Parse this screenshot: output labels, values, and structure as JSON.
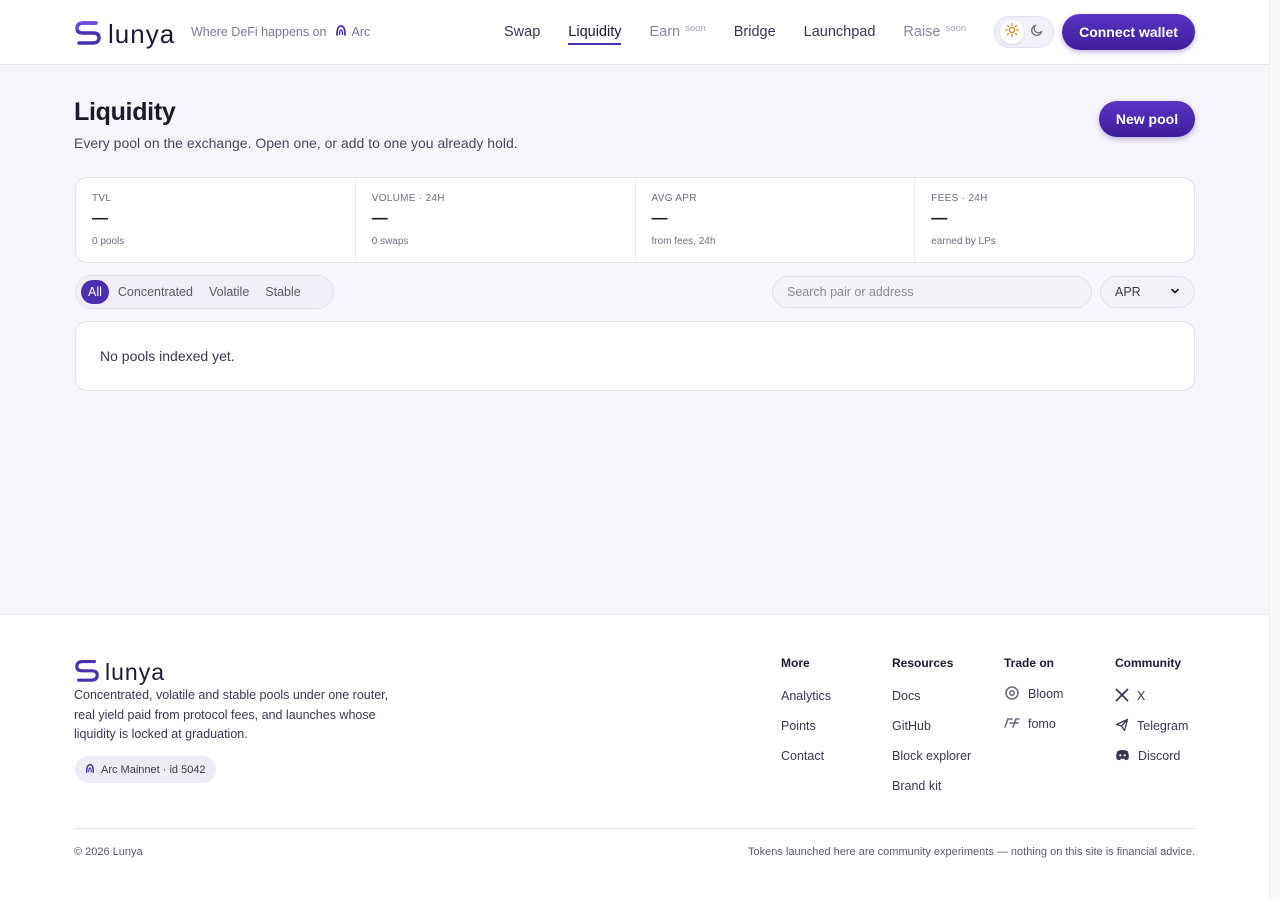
{
  "brand": {
    "name": "lunya",
    "accent": "#4a2fb0"
  },
  "header": {
    "tagline": "Where DeFi happens on",
    "chain": "Arc",
    "nav": [
      {
        "label": "Swap",
        "soon": ""
      },
      {
        "label": "Liquidity",
        "soon": ""
      },
      {
        "label": "Earn",
        "soon": "soon"
      },
      {
        "label": "Bridge",
        "soon": ""
      },
      {
        "label": "Launchpad",
        "soon": ""
      },
      {
        "label": "Raise",
        "soon": "soon"
      }
    ],
    "active_nav": "Liquidity",
    "theme_icons": [
      "sun-icon",
      "moon-icon"
    ],
    "connect_label": "Connect wallet"
  },
  "main": {
    "title": "Liquidity",
    "subtitle": "Every pool on the exchange. Open one, or add to one you already hold.",
    "new_pool_label": "New pool",
    "stats": [
      {
        "label": "TVL",
        "value": "—",
        "note": "0 pools"
      },
      {
        "label": "VOLUME · 24H",
        "value": "—",
        "note": "0 swaps"
      },
      {
        "label": "AVG APR",
        "value": "—",
        "note": "from fees, 24h"
      },
      {
        "label": "FEES · 24H",
        "value": "—",
        "note": "earned by LPs"
      }
    ],
    "filters": [
      "All",
      "Concentrated",
      "Volatile",
      "Stable"
    ],
    "active_filter": "All",
    "search_placeholder": "Search pair or address",
    "sort_value": "APR",
    "empty_message": "No pools indexed yet."
  },
  "footer": {
    "description": "Concentrated, volatile and stable pools under one router, real yield paid from protocol fees, and launches whose liquidity is locked at graduation.",
    "chain_badge": "Arc Mainnet · id 5042",
    "columns": {
      "more": {
        "title": "More",
        "links": [
          "Analytics",
          "Points",
          "Contact"
        ]
      },
      "resources": {
        "title": "Resources",
        "links": [
          "Docs",
          "GitHub",
          "Block explorer",
          "Brand kit"
        ]
      },
      "trade": {
        "title": "Trade on",
        "links": [
          "Bloom",
          "fomo"
        ]
      },
      "community": {
        "title": "Community",
        "links": [
          "X",
          "Telegram",
          "Discord"
        ]
      }
    },
    "copyright": "© 2026 Lunya",
    "disclaimer": "Tokens launched here are community experiments — nothing on this site is financial advice."
  }
}
